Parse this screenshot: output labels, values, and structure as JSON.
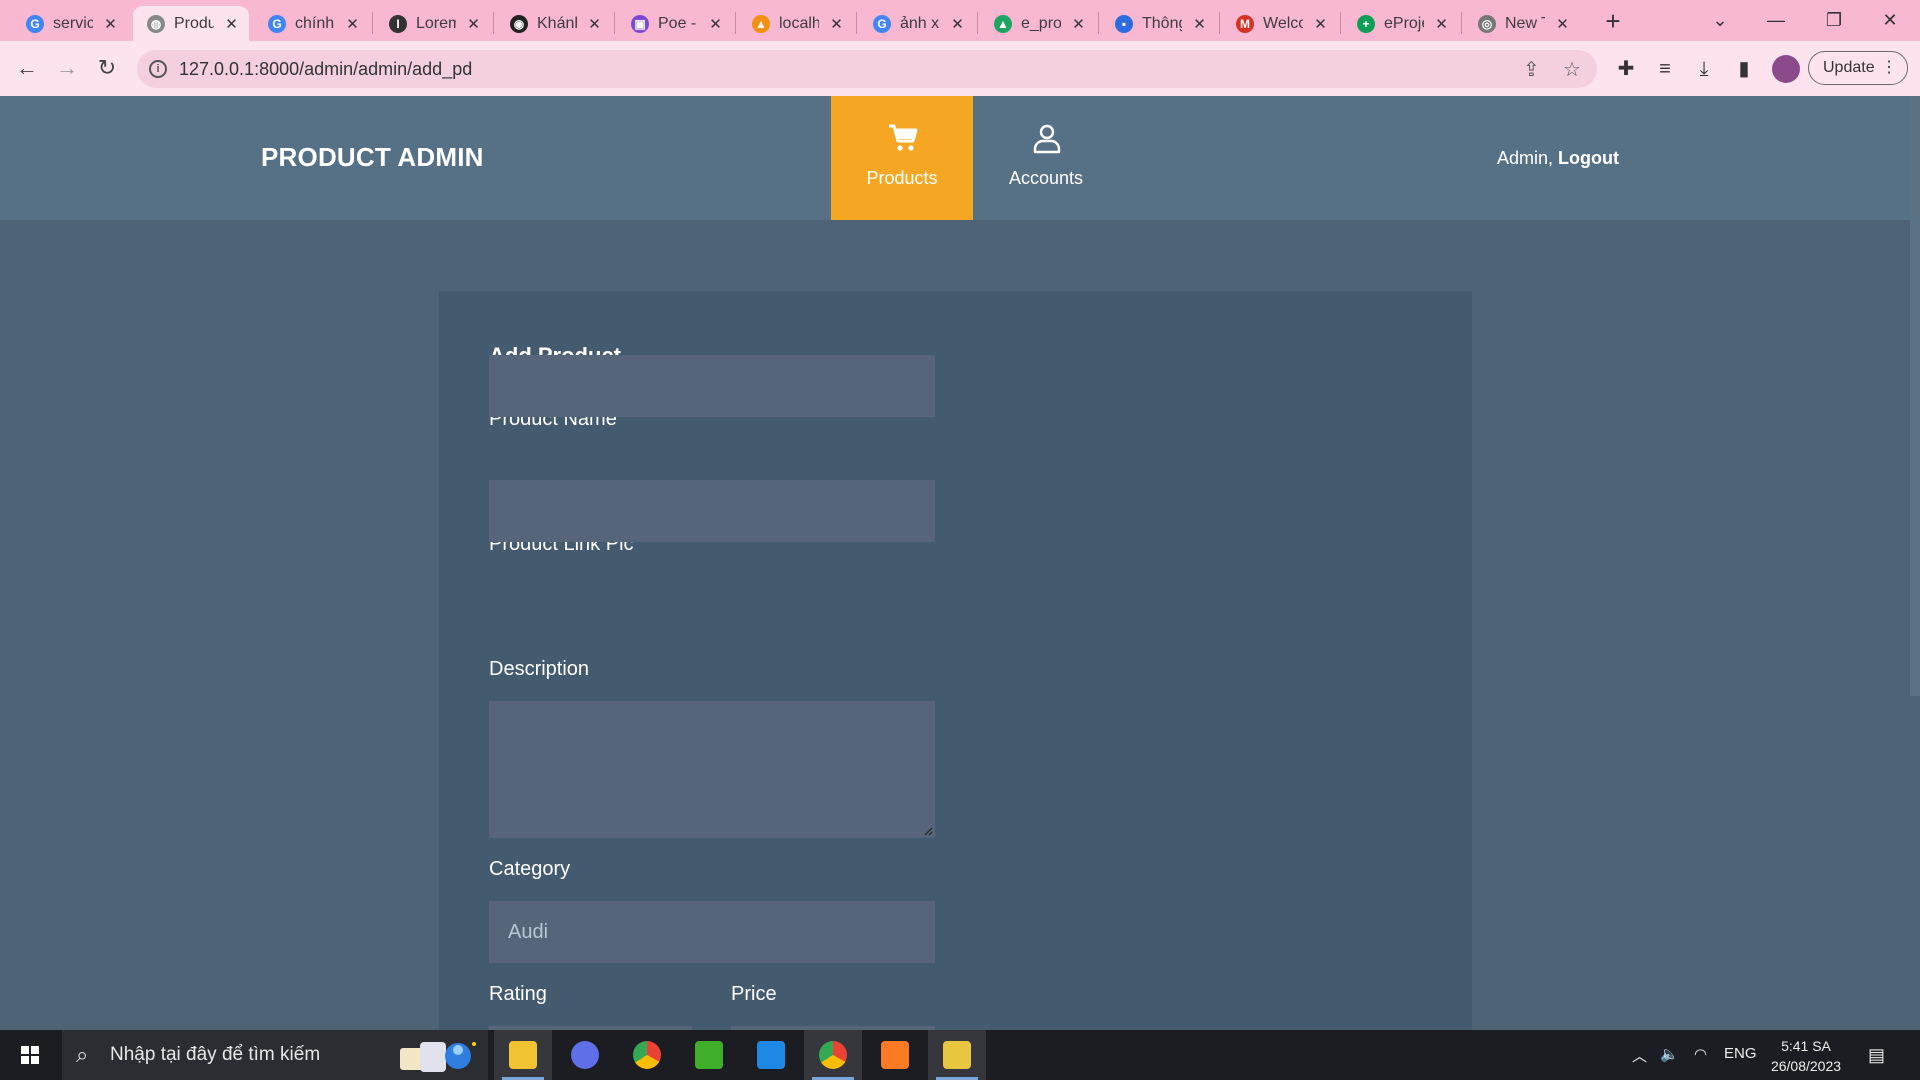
{
  "browser": {
    "tabs": [
      {
        "title": "service",
        "favicon": "google-icon",
        "color": "#4285f4",
        "glyph": "G"
      },
      {
        "title": "Products",
        "favicon": "globe-icon",
        "color": "#888888",
        "glyph": "◍",
        "active": true
      },
      {
        "title": "chính",
        "favicon": "google-icon",
        "color": "#4285f4",
        "glyph": "G"
      },
      {
        "title": "Lorem",
        "favicon": "lorem-ipsum-icon",
        "color": "#333333",
        "glyph": "I"
      },
      {
        "title": "Khánh",
        "favicon": "github-icon",
        "color": "#222222",
        "glyph": "◉"
      },
      {
        "title": "Poe - ",
        "favicon": "poe-icon",
        "color": "#7a49d6",
        "glyph": "▣"
      },
      {
        "title": "localhost",
        "favicon": "phpmyadmin-icon",
        "color": "#f29111",
        "glyph": "▲"
      },
      {
        "title": "ảnh xe",
        "favicon": "google-icon",
        "color": "#4285f4",
        "glyph": "G"
      },
      {
        "title": "e_proj",
        "favicon": "google-drive-icon",
        "color": "#1fa463",
        "glyph": "▲"
      },
      {
        "title": "Thông",
        "favicon": "classroom-icon",
        "color": "#2d6de0",
        "glyph": "▪"
      },
      {
        "title": "Welco",
        "favicon": "gmail-icon",
        "color": "#d93025",
        "glyph": "M"
      },
      {
        "title": "eProje",
        "favicon": "google-sheets-icon",
        "color": "#0f9d58",
        "glyph": "+"
      },
      {
        "title": "New T",
        "favicon": "chrome-icon",
        "color": "#777777",
        "glyph": "◎"
      }
    ],
    "new_tab": "+",
    "url": "127.0.0.1:8000/admin/admin/add_pd",
    "update_label": "Update"
  },
  "site": {
    "brand": "PRODUCT ADMIN",
    "nav": [
      {
        "label": "Products",
        "icon": "cart-icon",
        "active": true
      },
      {
        "label": "Accounts",
        "icon": "user-icon",
        "active": false
      }
    ],
    "user_name": "Admin,",
    "logout_label": "Logout",
    "accent_color": "#f5a623"
  },
  "form": {
    "title": "Add Product",
    "product_name_label": "Product Name",
    "product_name_value": "",
    "product_link_pic_label": "Product Link Pic",
    "product_link_pic_value": "",
    "description_label": "Description",
    "description_value": "",
    "category_label": "Category",
    "category_value": "Audi",
    "rating_label": "Rating",
    "price_label": "Price"
  },
  "taskbar": {
    "search_placeholder": "Nhập tại đây để tìm kiếm",
    "language": "ENG",
    "time": "5:41 SA",
    "date": "26/08/2023"
  }
}
